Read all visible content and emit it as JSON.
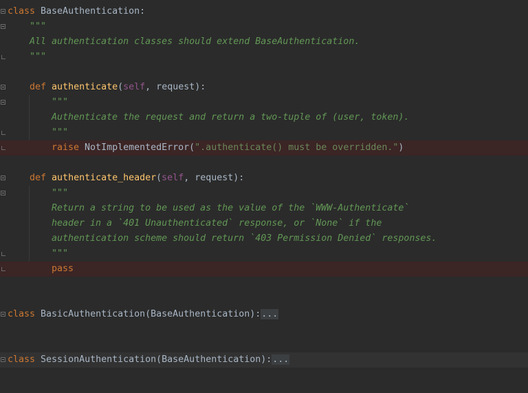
{
  "lines": {
    "l1": {
      "kw": "class",
      "rest": " BaseAuthentication:"
    },
    "l2": {
      "doc": "\"\"\""
    },
    "l3": {
      "doc": "All authentication classes should extend BaseAuthentication."
    },
    "l4": {
      "doc": "\"\"\""
    },
    "l6": {
      "kw": "def",
      "fn": "authenticate",
      "open": "(",
      "self": "self",
      "rest": ", request):"
    },
    "l7": {
      "doc": "\"\"\""
    },
    "l8": {
      "doc": "Authenticate the request and return a two-tuple of (user, token)."
    },
    "l9": {
      "doc": "\"\"\""
    },
    "l10": {
      "kw": "raise",
      "err": "NotImplementedError",
      "open": "(",
      "str": "\".authenticate() must be overridden.\"",
      "close": ")"
    },
    "l12": {
      "kw": "def",
      "fn": "authenticate_header",
      "open": "(",
      "self": "self",
      "rest": ", request):"
    },
    "l13": {
      "doc": "\"\"\""
    },
    "l14": {
      "doc": "Return a string to be used as the value of the `WWW-Authenticate`"
    },
    "l15": {
      "doc": "header in a `401 Unauthenticated` response, or `None` if the"
    },
    "l16": {
      "doc": "authentication scheme should return `403 Permission Denied` responses."
    },
    "l17": {
      "doc": "\"\"\""
    },
    "l18": {
      "kw": "pass"
    },
    "l21": {
      "kw": "class",
      "rest": " BasicAuthentication(BaseAuthentication):",
      "folded": "..."
    },
    "l24": {
      "kw": "class",
      "rest": " SessionAuthentication(BaseAuthentication):",
      "folded": "..."
    }
  },
  "colors": {
    "background": "#2b2b2b",
    "keyword": "#cc7832",
    "function": "#ffc66d",
    "self": "#94558d",
    "docstring": "#629755",
    "string": "#6a8759",
    "error_line": "#3b2525"
  }
}
